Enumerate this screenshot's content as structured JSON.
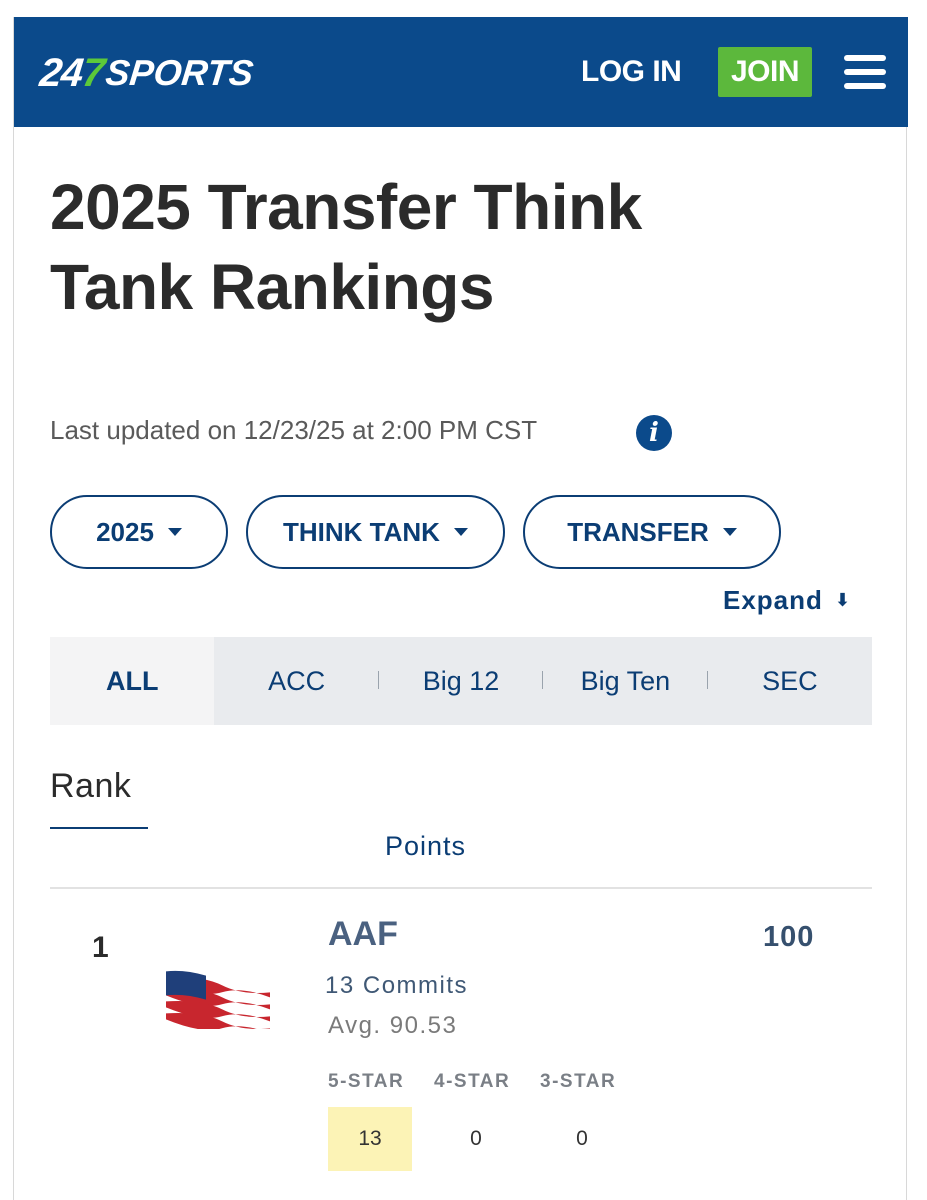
{
  "header": {
    "logo_prefix": "24",
    "logo_seven": "7",
    "logo_suffix": "SPORTS",
    "login_label": "LOG IN",
    "join_label": "JOIN",
    "menu_icon": "hamburger-menu-icon",
    "bg_color": "#0b4a8b",
    "accent_green": "#5cb83c"
  },
  "page": {
    "title": "2025 Transfer Think Tank Rankings",
    "updated": "Last updated on 12/23/25 at 2:00 PM CST",
    "info_glyph": "i"
  },
  "filters": [
    {
      "label": "2025"
    },
    {
      "label": "THINK TANK"
    },
    {
      "label": "TRANSFER"
    }
  ],
  "expand_label": "Expand",
  "expand_arrow": "⬇",
  "conferences": [
    {
      "label": "ALL",
      "active": true
    },
    {
      "label": "ACC",
      "active": false
    },
    {
      "label": "Big 12",
      "active": false
    },
    {
      "label": "Big Ten",
      "active": false
    },
    {
      "label": "SEC",
      "active": false
    }
  ],
  "table": {
    "rank_header": "Rank",
    "points_header": "Points",
    "rows": [
      {
        "rank": "1",
        "team": "AAF",
        "points": "100",
        "commits": "13 Commits",
        "avg": "Avg. 90.53",
        "stars": [
          {
            "label": "5-STAR",
            "value": "13",
            "highlight": true
          },
          {
            "label": "4-STAR",
            "value": "0",
            "highlight": false
          },
          {
            "label": "3-STAR",
            "value": "0",
            "highlight": false
          }
        ]
      }
    ]
  }
}
